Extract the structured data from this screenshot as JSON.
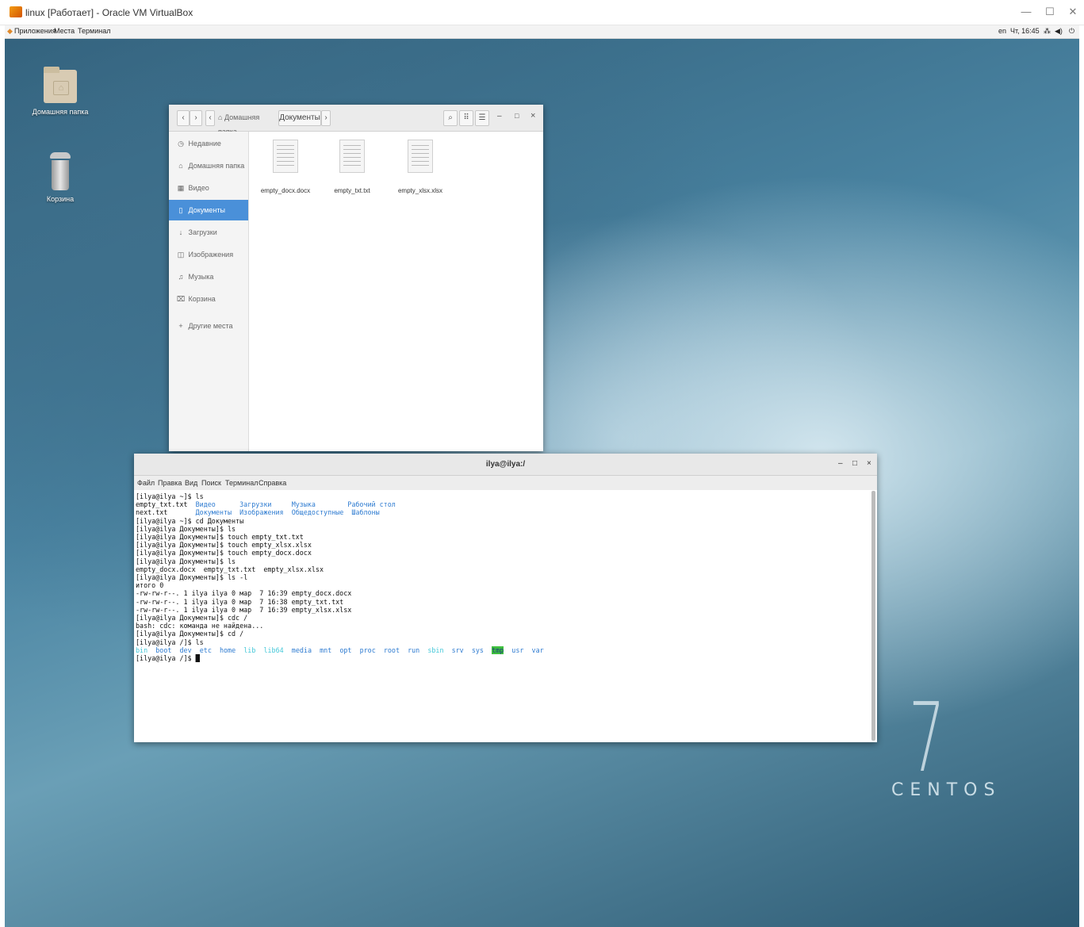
{
  "host": {
    "title": "linux [Работает] - Oracle VM VirtualBox",
    "controls": {
      "minimize": "—",
      "maximize": "☐",
      "close": "✕"
    }
  },
  "gnome_topbar": {
    "menus": [
      "Приложения",
      "Места",
      "Терминал"
    ],
    "right": {
      "lang": "en",
      "clock": "Чт, 16:45",
      "network": "⁂",
      "volume": "◀)",
      "power": "⏻"
    }
  },
  "desktop": {
    "icons": [
      {
        "label": "Домашняя папка"
      },
      {
        "label": "Корзина"
      }
    ],
    "brand": {
      "number": "7",
      "word": "CENTOS"
    }
  },
  "nautilus": {
    "nav": {
      "back": "‹",
      "forward": "›",
      "path_left": "‹"
    },
    "breadcrumbs": [
      "Домашняя папка",
      "Документы"
    ],
    "path_right": "›",
    "toolbar": {
      "search": "⌕",
      "view_grid": "⠿",
      "menu": "☰"
    },
    "window_controls": {
      "minimize": "–",
      "maximize": "□",
      "close": "×"
    },
    "sidebar": [
      {
        "icon": "◷",
        "label": "Недавние",
        "active": false
      },
      {
        "icon": "⌂",
        "label": "Домашняя папка",
        "active": false
      },
      {
        "icon": "▦",
        "label": "Видео",
        "active": false
      },
      {
        "icon": "▯",
        "label": "Документы",
        "active": true
      },
      {
        "icon": "↓",
        "label": "Загрузки",
        "active": false
      },
      {
        "icon": "◫",
        "label": "Изображения",
        "active": false
      },
      {
        "icon": "♫",
        "label": "Музыка",
        "active": false
      },
      {
        "icon": "⌧",
        "label": "Корзина",
        "active": false
      },
      {
        "icon": "+",
        "label": "Другие места",
        "active": false
      }
    ],
    "files": [
      {
        "name": "empty_docx.docx"
      },
      {
        "name": "empty_txt.txt"
      },
      {
        "name": "empty_xlsx.xlsx"
      }
    ]
  },
  "terminal": {
    "title": "ilya@ilya:/",
    "controls": {
      "minimize": "–",
      "maximize": "□",
      "close": "×"
    },
    "menu": [
      "Файл",
      "Правка",
      "Вид",
      "Поиск",
      "Терминал",
      "Справка"
    ],
    "lines": [
      [
        {
          "t": "[ilya@ilya ~]$ ls"
        }
      ],
      [
        {
          "t": "empty_txt.txt  "
        },
        {
          "t": "Видео",
          "c": "blue"
        },
        {
          "t": "      "
        },
        {
          "t": "Загрузки",
          "c": "blue"
        },
        {
          "t": "     "
        },
        {
          "t": "Музыка",
          "c": "blue"
        },
        {
          "t": "        "
        },
        {
          "t": "Рабочий стол",
          "c": "blue"
        }
      ],
      [
        {
          "t": "next.txt       "
        },
        {
          "t": "Документы",
          "c": "blue"
        },
        {
          "t": "  "
        },
        {
          "t": "Изображения",
          "c": "blue"
        },
        {
          "t": "  "
        },
        {
          "t": "Общедоступные",
          "c": "blue"
        },
        {
          "t": "  "
        },
        {
          "t": "Шаблоны",
          "c": "blue"
        }
      ],
      [
        {
          "t": "[ilya@ilya ~]$ cd Документы"
        }
      ],
      [
        {
          "t": "[ilya@ilya Документы]$ ls"
        }
      ],
      [
        {
          "t": "[ilya@ilya Документы]$ touch empty_txt.txt"
        }
      ],
      [
        {
          "t": "[ilya@ilya Документы]$ touch empty_xlsx.xlsx"
        }
      ],
      [
        {
          "t": "[ilya@ilya Документы]$ touch empty_docx.docx"
        }
      ],
      [
        {
          "t": "[ilya@ilya Документы]$ ls"
        }
      ],
      [
        {
          "t": "empty_docx.docx  empty_txt.txt  empty_xlsx.xlsx"
        }
      ],
      [
        {
          "t": "[ilya@ilya Документы]$ ls -l"
        }
      ],
      [
        {
          "t": "итого 0"
        }
      ],
      [
        {
          "t": "-rw-rw-r--. 1 ilya ilya 0 мар  7 16:39 empty_docx.docx"
        }
      ],
      [
        {
          "t": "-rw-rw-r--. 1 ilya ilya 0 мар  7 16:38 empty_txt.txt"
        }
      ],
      [
        {
          "t": "-rw-rw-r--. 1 ilya ilya 0 мар  7 16:39 empty_xlsx.xlsx"
        }
      ],
      [
        {
          "t": "[ilya@ilya Документы]$ cdc /"
        }
      ],
      [
        {
          "t": "bash: cdc: команда не найдена..."
        }
      ],
      [
        {
          "t": "[ilya@ilya Документы]$ cd /"
        }
      ],
      [
        {
          "t": "[ilya@ilya /]$ ls"
        }
      ],
      [
        {
          "t": "bin",
          "c": "cyan"
        },
        {
          "t": "  "
        },
        {
          "t": "boot",
          "c": "blue"
        },
        {
          "t": "  "
        },
        {
          "t": "dev",
          "c": "blue"
        },
        {
          "t": "  "
        },
        {
          "t": "etc",
          "c": "blue"
        },
        {
          "t": "  "
        },
        {
          "t": "home",
          "c": "blue"
        },
        {
          "t": "  "
        },
        {
          "t": "lib",
          "c": "cyan"
        },
        {
          "t": "  "
        },
        {
          "t": "lib64",
          "c": "cyan"
        },
        {
          "t": "  "
        },
        {
          "t": "media",
          "c": "blue"
        },
        {
          "t": "  "
        },
        {
          "t": "mnt",
          "c": "blue"
        },
        {
          "t": "  "
        },
        {
          "t": "opt",
          "c": "blue"
        },
        {
          "t": "  "
        },
        {
          "t": "proc",
          "c": "blue"
        },
        {
          "t": "  "
        },
        {
          "t": "root",
          "c": "blue"
        },
        {
          "t": "  "
        },
        {
          "t": "run",
          "c": "blue"
        },
        {
          "t": "  "
        },
        {
          "t": "sbin",
          "c": "cyan"
        },
        {
          "t": "  "
        },
        {
          "t": "srv",
          "c": "blue"
        },
        {
          "t": "  "
        },
        {
          "t": "sys",
          "c": "blue"
        },
        {
          "t": "  "
        },
        {
          "t": "tmp",
          "c": "hl"
        },
        {
          "t": "  "
        },
        {
          "t": "usr",
          "c": "blue"
        },
        {
          "t": "  "
        },
        {
          "t": "var",
          "c": "blue"
        }
      ],
      [
        {
          "t": "[ilya@ilya /]$ "
        },
        {
          "t": "█",
          "c": "cursor"
        }
      ]
    ]
  },
  "colors": {
    "accent": "#4a90d9",
    "dir_blue": "#2f7cd1",
    "link_cyan": "#45c8d9",
    "tmp_highlight": "#3fbf3f"
  }
}
